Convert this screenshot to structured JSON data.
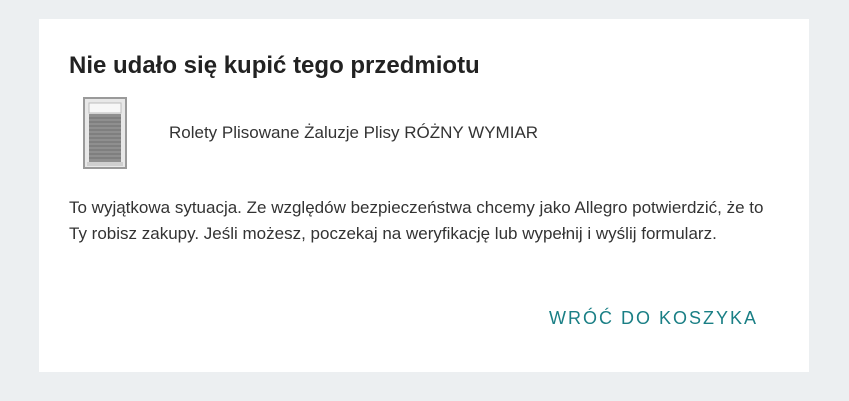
{
  "dialog": {
    "title": "Nie udało się kupić tego przedmiotu",
    "product": {
      "name": "Rolety Plisowane Żaluzje Plisy RÓŻNY WYMIAR",
      "image_icon": "pleated-blind-icon"
    },
    "message": "To wyjątkowa sytuacja. Ze względów bezpieczeństwa chcemy jako Allegro potwierdzić, że to Ty robisz zakupy. Jeśli możesz, poczekaj na weryfikację lub wypełnij i wyślij formularz.",
    "back_button_label": "WRÓĆ DO KOSZYKA"
  },
  "colors": {
    "page_background": "#eceff1",
    "card_background": "#ffffff",
    "accent": "#1a7f85",
    "text": "#222222"
  }
}
